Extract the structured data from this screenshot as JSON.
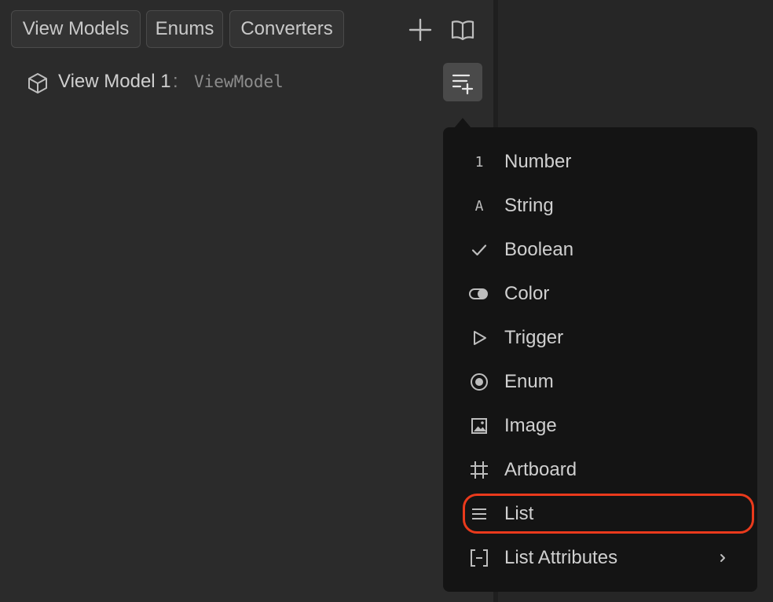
{
  "tabs": [
    {
      "label": "View Models"
    },
    {
      "label": "Enums"
    },
    {
      "label": "Converters"
    }
  ],
  "toolbar": {
    "add_icon": "plus-icon",
    "docs_icon": "book-icon"
  },
  "view_model": {
    "icon": "cube-icon",
    "name": "View Model 1",
    "colon": ":",
    "type": "ViewModel"
  },
  "add_property_button": {
    "icon": "list-add-icon"
  },
  "menu": {
    "items": [
      {
        "label": "Number",
        "icon": "number-icon",
        "glyph": "1"
      },
      {
        "label": "String",
        "icon": "string-icon",
        "glyph": "A"
      },
      {
        "label": "Boolean",
        "icon": "checkmark-icon"
      },
      {
        "label": "Color",
        "icon": "color-toggle-icon"
      },
      {
        "label": "Trigger",
        "icon": "play-triangle-icon"
      },
      {
        "label": "Enum",
        "icon": "radio-icon"
      },
      {
        "label": "Image",
        "icon": "image-icon"
      },
      {
        "label": "Artboard",
        "icon": "hash-frame-icon"
      },
      {
        "label": "List",
        "icon": "list-lines-icon"
      },
      {
        "label": "List Attributes",
        "icon": "bracket-minus-icon",
        "has_submenu": true
      }
    ]
  },
  "colors": {
    "highlight": "#ea3a1c",
    "menu_background": "#141414",
    "panel_background": "#2b2b2b"
  }
}
